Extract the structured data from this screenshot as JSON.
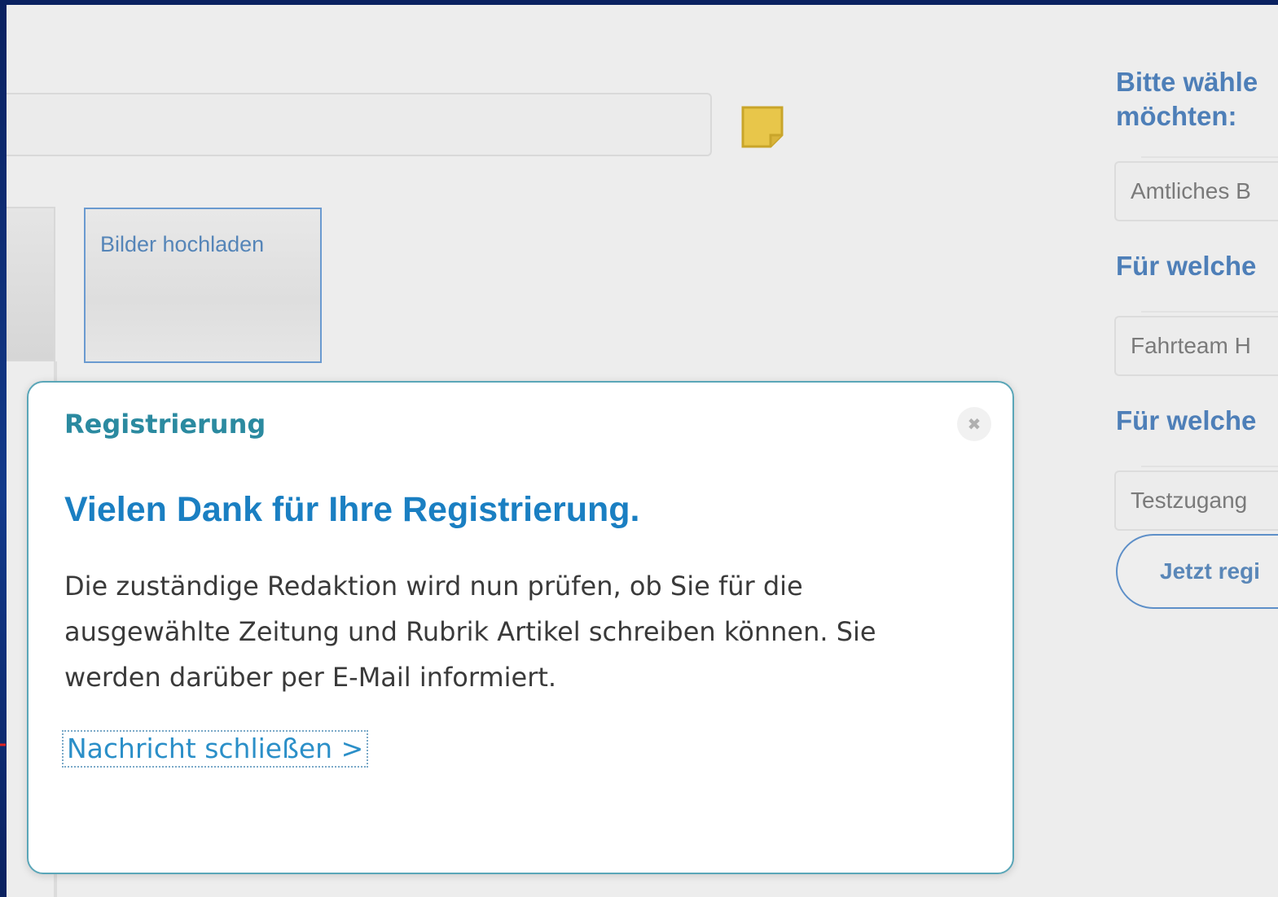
{
  "background_colors": {
    "slide": "#0d2a6e",
    "screen": "#ededed",
    "accent_teal": "#2b8aa0",
    "accent_blue": "#1a7fc2",
    "annotation_red": "#e02020"
  },
  "editor": {
    "upload_button_label": "Bilder hochladen",
    "note_icon": "sticky-note-icon"
  },
  "registration_form": {
    "heading": "Bitte wähle\nmöchten:",
    "select_1_value": "Amtliches B",
    "label_2": "Für welche",
    "select_2_value": "Fahrteam H",
    "label_3": "Für welche",
    "select_3_value": "Testzugang",
    "submit_label": "Jetzt regi"
  },
  "modal": {
    "title": "Registrierung",
    "close_icon": "close-icon",
    "close_glyph": "✖",
    "heading": "Vielen Dank für Ihre Registrierung.",
    "body": "Die zuständige Redaktion wird nun prüfen, ob Sie für die ausgewählte Zeitung und Rubrik Artikel schreiben können. Sie werden darüber per E-Mail informiert.",
    "close_link": "Nachricht schließen >"
  }
}
